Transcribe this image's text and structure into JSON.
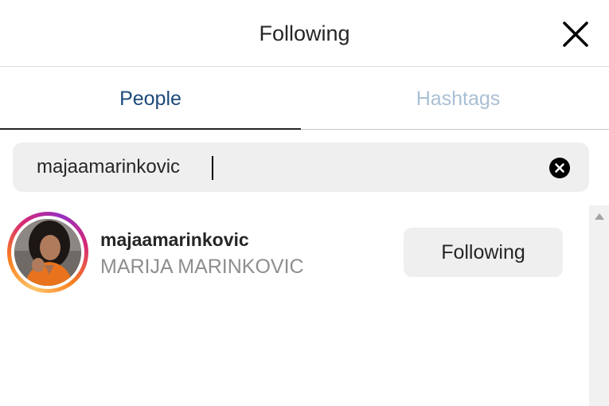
{
  "header": {
    "title": "Following",
    "close_icon": "close-icon"
  },
  "tabs": [
    {
      "label": "People",
      "active": true
    },
    {
      "label": "Hashtags",
      "active": false
    }
  ],
  "search": {
    "value": "majaamarinkovic",
    "clear_icon": "clear-circle-icon"
  },
  "results": [
    {
      "username": "majaamarinkovic",
      "full_name": "MARIJA MARINKOVIC",
      "has_story_ring": true,
      "button_label": "Following"
    }
  ],
  "colors": {
    "active_tab": "#1c4a7a",
    "inactive_tab": "#a9bfd4",
    "button_bg": "#efefef",
    "secondary_text": "#8e8e8e"
  }
}
